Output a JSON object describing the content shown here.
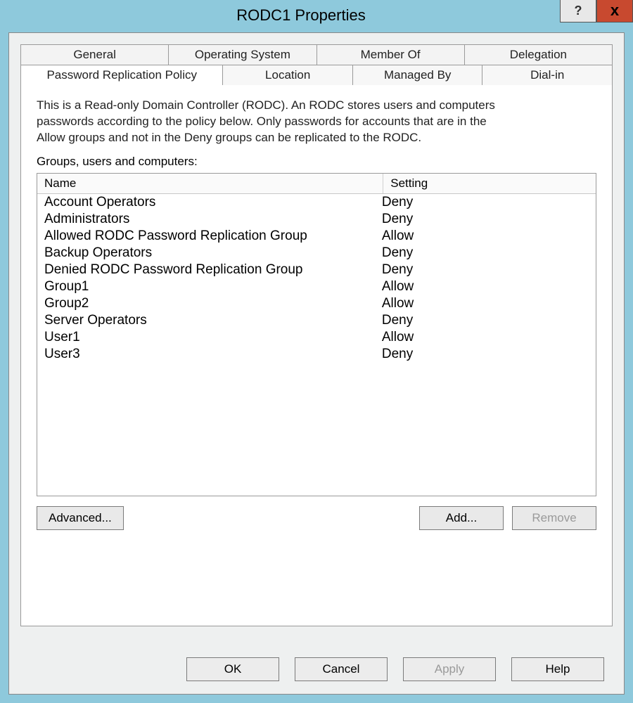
{
  "window": {
    "title": "RODC1 Properties",
    "help": "?",
    "close": "x"
  },
  "tabs_row1": [
    "General",
    "Operating System",
    "Member Of",
    "Delegation"
  ],
  "tabs_row2": [
    "Password Replication Policy",
    "Location",
    "Managed By",
    "Dial-in"
  ],
  "active_tab": "Password Replication Policy",
  "description": "This is a Read-only Domain Controller (RODC).  An RODC stores users and computers passwords according to the policy below.  Only passwords for accounts that are in the Allow groups and not in the Deny groups can be replicated to the RODC.",
  "list_label": "Groups, users and computers:",
  "columns": {
    "name": "Name",
    "setting": "Setting"
  },
  "rows": [
    {
      "name": "Account Operators",
      "setting": "Deny"
    },
    {
      "name": "Administrators",
      "setting": "Deny"
    },
    {
      "name": "Allowed RODC Password Replication Group",
      "setting": "Allow"
    },
    {
      "name": "Backup Operators",
      "setting": "Deny"
    },
    {
      "name": "Denied RODC Password Replication Group",
      "setting": "Deny"
    },
    {
      "name": "Group1",
      "setting": "Allow"
    },
    {
      "name": "Group2",
      "setting": "Allow"
    },
    {
      "name": "Server Operators",
      "setting": "Deny"
    },
    {
      "name": "User1",
      "setting": "Allow"
    },
    {
      "name": "User3",
      "setting": "Deny"
    }
  ],
  "buttons": {
    "advanced": "Advanced...",
    "add": "Add...",
    "remove": "Remove"
  },
  "footer": {
    "ok": "OK",
    "cancel": "Cancel",
    "apply": "Apply",
    "help": "Help"
  }
}
